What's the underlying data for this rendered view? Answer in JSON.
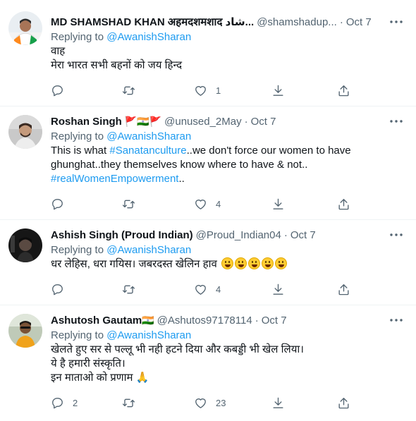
{
  "tweets": [
    {
      "name": "MD SHAMSHAD KHAN अहमदशमशाद شاد...",
      "flags": "",
      "handle": "@shamshadup...",
      "separator": "·",
      "date": "Oct 7",
      "replying_prefix": "Replying to ",
      "replying_to": "@AwanishSharan",
      "lines": [
        "वाह",
        "मेरा भारत सभी बहनों को जय हिन्द"
      ],
      "reply_count": "",
      "retweet_count": "",
      "like_count": "1"
    },
    {
      "name": "Roshan Singh",
      "flags": "🚩🇮🇳🚩",
      "handle": "@unused_2May",
      "separator": "·",
      "date": "Oct 7",
      "replying_prefix": "Replying to ",
      "replying_to": "@AwanishSharan",
      "text_parts": [
        "This is what ",
        "#Sanatanculture",
        "..we don't force our women to have",
        "ghunghat..they themselves know where to have & not..",
        "#realWomenEmpowerment",
        ".."
      ],
      "reply_count": "",
      "retweet_count": "",
      "like_count": "4"
    },
    {
      "name": "Ashish Singh (Proud Indian)",
      "flags": "",
      "handle": "@Proud_Indian04",
      "separator": "·",
      "date": "Oct 7",
      "replying_prefix": "Replying to ",
      "replying_to": "@AwanishSharan",
      "lines": [
        "धर लेहिस, धरा गयिस। जबरदस्त खेलिन हाव"
      ],
      "emoji_count": 5,
      "reply_count": "",
      "retweet_count": "",
      "like_count": "4"
    },
    {
      "name": "Ashutosh Gautam",
      "flags": "🇮🇳",
      "handle": "@Ashutos97178114",
      "separator": "·",
      "date": "Oct 7",
      "replying_prefix": "Replying to ",
      "replying_to": "@AwanishSharan",
      "lines": [
        "खेलते हुए सर से पल्लू भी नही हटने दिया और कबड्डी भी खेल लिया।",
        "ये है हमारी संस्कृति।",
        "इन माताओ को प्रणाम 🙏"
      ],
      "reply_count": "2",
      "retweet_count": "",
      "like_count": "23"
    }
  ],
  "icons": {
    "more": "more-horizontal-icon",
    "reply": "reply-icon",
    "retweet": "retweet-icon",
    "like": "heart-icon",
    "share": "share-icon",
    "upload": "upload-icon"
  },
  "colors": {
    "link": "#1d9bf0",
    "secondary_text": "#536471",
    "primary_text": "#0f1419",
    "divider": "#eff3f4"
  }
}
